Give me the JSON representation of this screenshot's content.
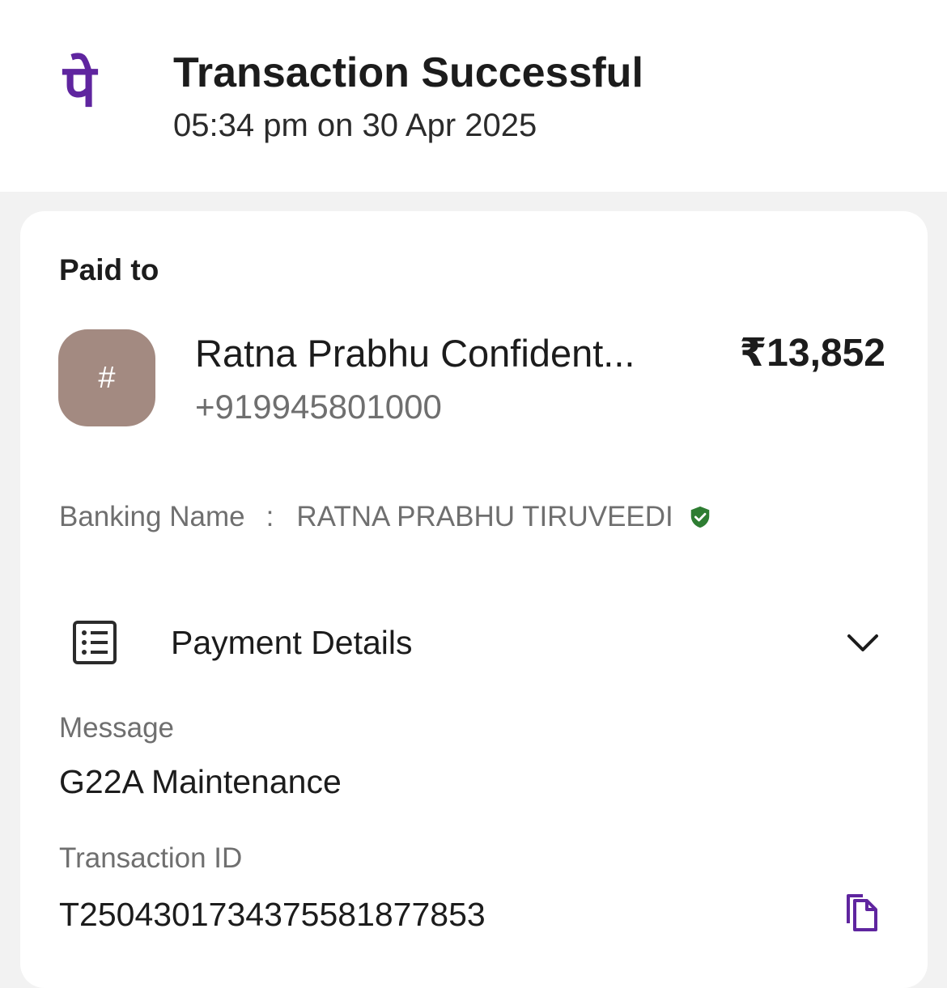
{
  "header": {
    "logo_glyph": "पे",
    "logo_color": "#5f259f",
    "title": "Transaction Successful",
    "datetime": "05:34 pm on 30 Apr 2025"
  },
  "paid_to": {
    "label": "Paid to",
    "avatar_text": "#",
    "avatar_color": "#a38a81",
    "name": "Ratna Prabhu Confident...",
    "phone": "+919945801000",
    "amount": "₹13,852"
  },
  "banking": {
    "label": "Banking Name",
    "separator": ":",
    "name": "RATNA PRABHU TIRUVEEDI",
    "verified_icon": "verified-shield-icon",
    "verified_color": "#2e7d32"
  },
  "payment_details": {
    "label": "Payment Details",
    "icon": "receipt-list-icon",
    "toggle_icon": "chevron-down-icon"
  },
  "message": {
    "label": "Message",
    "value": "G22A Maintenance"
  },
  "transaction": {
    "label": "Transaction ID",
    "value": "T2504301734375581877853",
    "copy_icon": "copy-icon"
  }
}
